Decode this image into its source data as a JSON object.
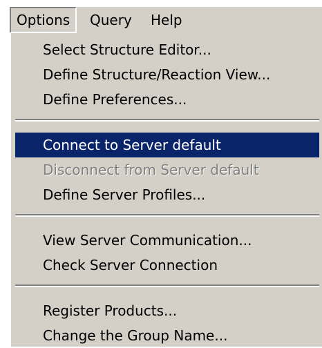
{
  "menubar": {
    "items": [
      {
        "label": "Options",
        "active": true
      },
      {
        "label": "Query",
        "active": false
      },
      {
        "label": "Help",
        "active": false
      }
    ]
  },
  "menu": {
    "items": [
      {
        "label": "Select Structure Editor...",
        "state": "normal"
      },
      {
        "label": "Define Structure/Reaction View...",
        "state": "normal"
      },
      {
        "label": "Define Preferences...",
        "state": "normal"
      },
      {
        "label": "Connect to Server default",
        "state": "highlighted"
      },
      {
        "label": "Disconnect from Server default",
        "state": "disabled"
      },
      {
        "label": "Define Server Profiles...",
        "state": "normal"
      },
      {
        "label": "View Server Communication...",
        "state": "normal"
      },
      {
        "label": "Check Server Connection",
        "state": "normal",
        "submenu_icon": "chevron-right-icon"
      },
      {
        "label": "Register Products...",
        "state": "normal"
      },
      {
        "label": "Change the Group Name...",
        "state": "normal"
      }
    ]
  },
  "colors": {
    "menu_background": "#d4d0c8",
    "highlight_background": "#0a246a",
    "highlight_text": "#ffffff",
    "disabled_text": "#808080"
  }
}
